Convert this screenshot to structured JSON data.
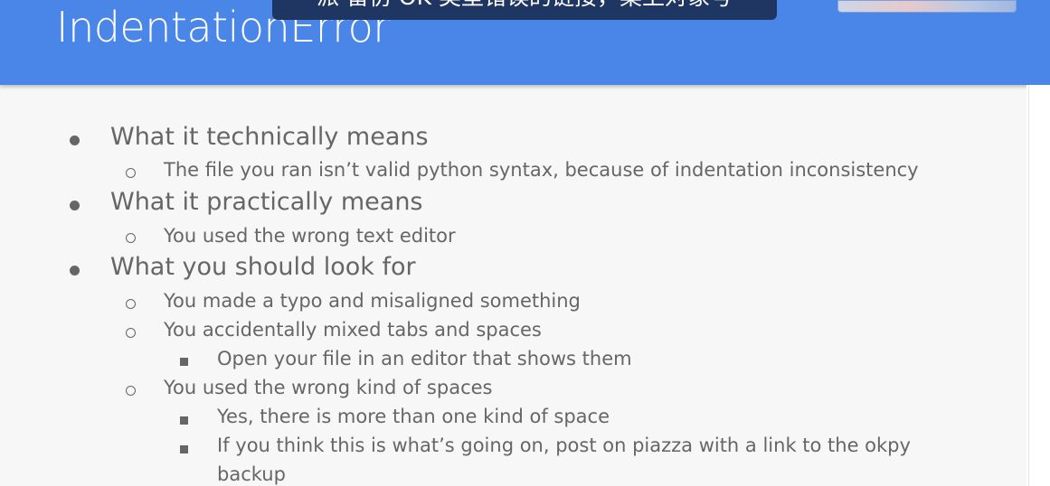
{
  "slide": {
    "title": "IndentationError",
    "header_color": "#4a86e8",
    "text_color": "#666666"
  },
  "overlay": {
    "caption": "派 留仿 OK 类型错误的链接，桌上对象号"
  },
  "bullets": [
    {
      "level": 1,
      "text": "What it technically means"
    },
    {
      "level": 2,
      "text": "The file you ran isn’t valid python syntax, because of indentation inconsistency"
    },
    {
      "level": 1,
      "text": "What it practically means"
    },
    {
      "level": 2,
      "text": "You used the wrong text editor"
    },
    {
      "level": 1,
      "text": "What you should look for"
    },
    {
      "level": 2,
      "text": "You made a typo and misaligned something"
    },
    {
      "level": 2,
      "text": "You accidentally mixed tabs and spaces"
    },
    {
      "level": 3,
      "text": "Open your file in an editor that shows them"
    },
    {
      "level": 2,
      "text": "You used the wrong kind of spaces"
    },
    {
      "level": 3,
      "text": "Yes, there is more than one kind of space"
    },
    {
      "level": 3,
      "text": "If you think this is what’s going on, post on piazza with a link to the okpy"
    },
    {
      "level": 3,
      "text": "backup"
    }
  ]
}
